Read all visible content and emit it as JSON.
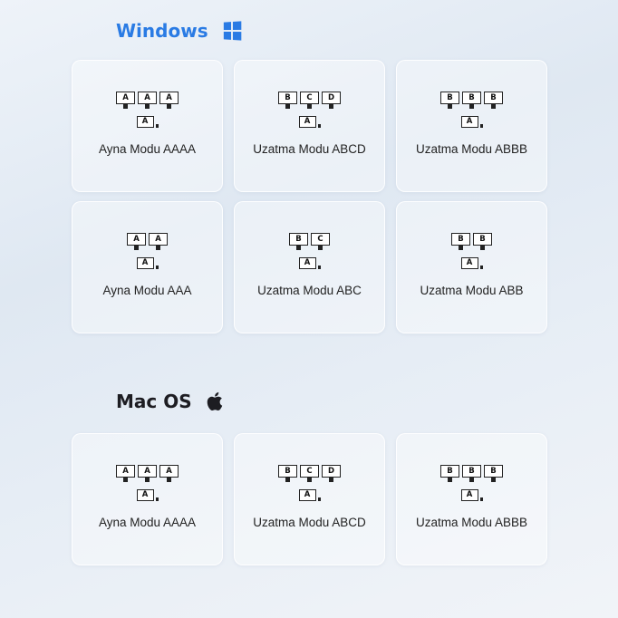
{
  "sections": [
    {
      "title": "Windows",
      "icon": "windows-logo-icon",
      "cards": [
        {
          "label": "Ayna Modu AAAA",
          "monitors": [
            "A",
            "A",
            "A"
          ],
          "laptop": "A"
        },
        {
          "label": "Uzatma Modu ABCD",
          "monitors": [
            "B",
            "C",
            "D"
          ],
          "laptop": "A"
        },
        {
          "label": "Uzatma Modu ABBB",
          "monitors": [
            "B",
            "B",
            "B"
          ],
          "laptop": "A"
        },
        {
          "label": "Ayna Modu AAA",
          "monitors": [
            "A",
            "A"
          ],
          "laptop": "A"
        },
        {
          "label": "Uzatma Modu ABC",
          "monitors": [
            "B",
            "C"
          ],
          "laptop": "A"
        },
        {
          "label": "Uzatma Modu ABB",
          "monitors": [
            "B",
            "B"
          ],
          "laptop": "A"
        }
      ]
    },
    {
      "title": "Mac OS",
      "icon": "apple-logo-icon",
      "cards": [
        {
          "label": "Ayna Modu AAAA",
          "monitors": [
            "A",
            "A",
            "A"
          ],
          "laptop": "A"
        },
        {
          "label": "Uzatma Modu ABCD",
          "monitors": [
            "B",
            "C",
            "D"
          ],
          "laptop": "A"
        },
        {
          "label": "Uzatma Modu ABBB",
          "monitors": [
            "B",
            "B",
            "B"
          ],
          "laptop": "A"
        }
      ]
    }
  ],
  "colors": {
    "windows_accent": "#2a7be4",
    "mac_title": "#1d1d22",
    "icon_stroke": "#222222"
  }
}
